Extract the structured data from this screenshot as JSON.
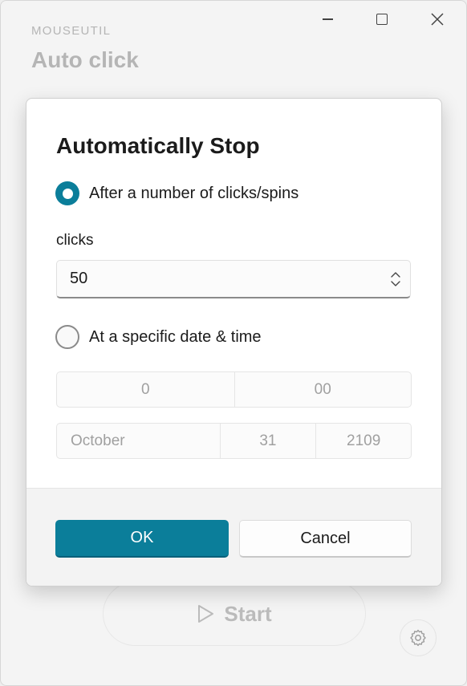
{
  "window": {
    "app_name": "MOUSEUTIL",
    "page_title": "Auto click",
    "start_label": "Start"
  },
  "dialog": {
    "title": "Automatically Stop",
    "option_clicks_label": "After a number of clicks/spins",
    "option_clicks_selected": true,
    "clicks_field_label": "clicks",
    "clicks_value": "50",
    "option_datetime_label": "At a specific date & time",
    "option_datetime_selected": false,
    "time": {
      "hour": "0",
      "minute": "00"
    },
    "date": {
      "month": "October",
      "day": "31",
      "year": "2109"
    },
    "ok_label": "OK",
    "cancel_label": "Cancel"
  },
  "icons": {
    "minimize": "minimize-icon",
    "maximize": "maximize-icon",
    "close": "close-icon",
    "play": "play-icon",
    "settings": "gear-icon",
    "spin": "chevron-up-down-icon"
  },
  "colors": {
    "accent": "#0b7e9a",
    "background": "#f3f3f3",
    "dialog_background": "#ffffff"
  }
}
